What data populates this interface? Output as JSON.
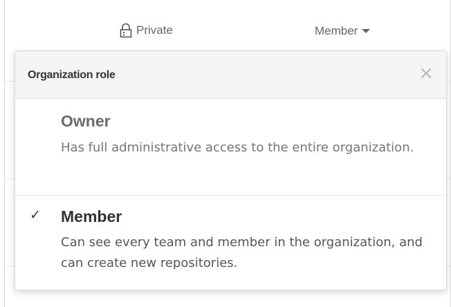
{
  "top_row": {
    "visibility_label": "Private",
    "visibility_icon": "lock-icon",
    "role_toggle_label": "Member",
    "role_toggle_icon": "caret-down-icon"
  },
  "popover": {
    "title": "Organization role",
    "close_icon": "close-icon",
    "options": [
      {
        "name": "Owner",
        "description": "Has full administrative access to the entire organization.",
        "selected": false
      },
      {
        "name": "Member",
        "description": "Can see every team and member in the organization, and can create new repositories.",
        "selected": true
      }
    ],
    "check_glyph": "✓"
  },
  "colors": {
    "header_bg": "#f5f5f5",
    "text_primary": "#333333",
    "text_muted": "#666666",
    "border": "#d9d9d9"
  }
}
